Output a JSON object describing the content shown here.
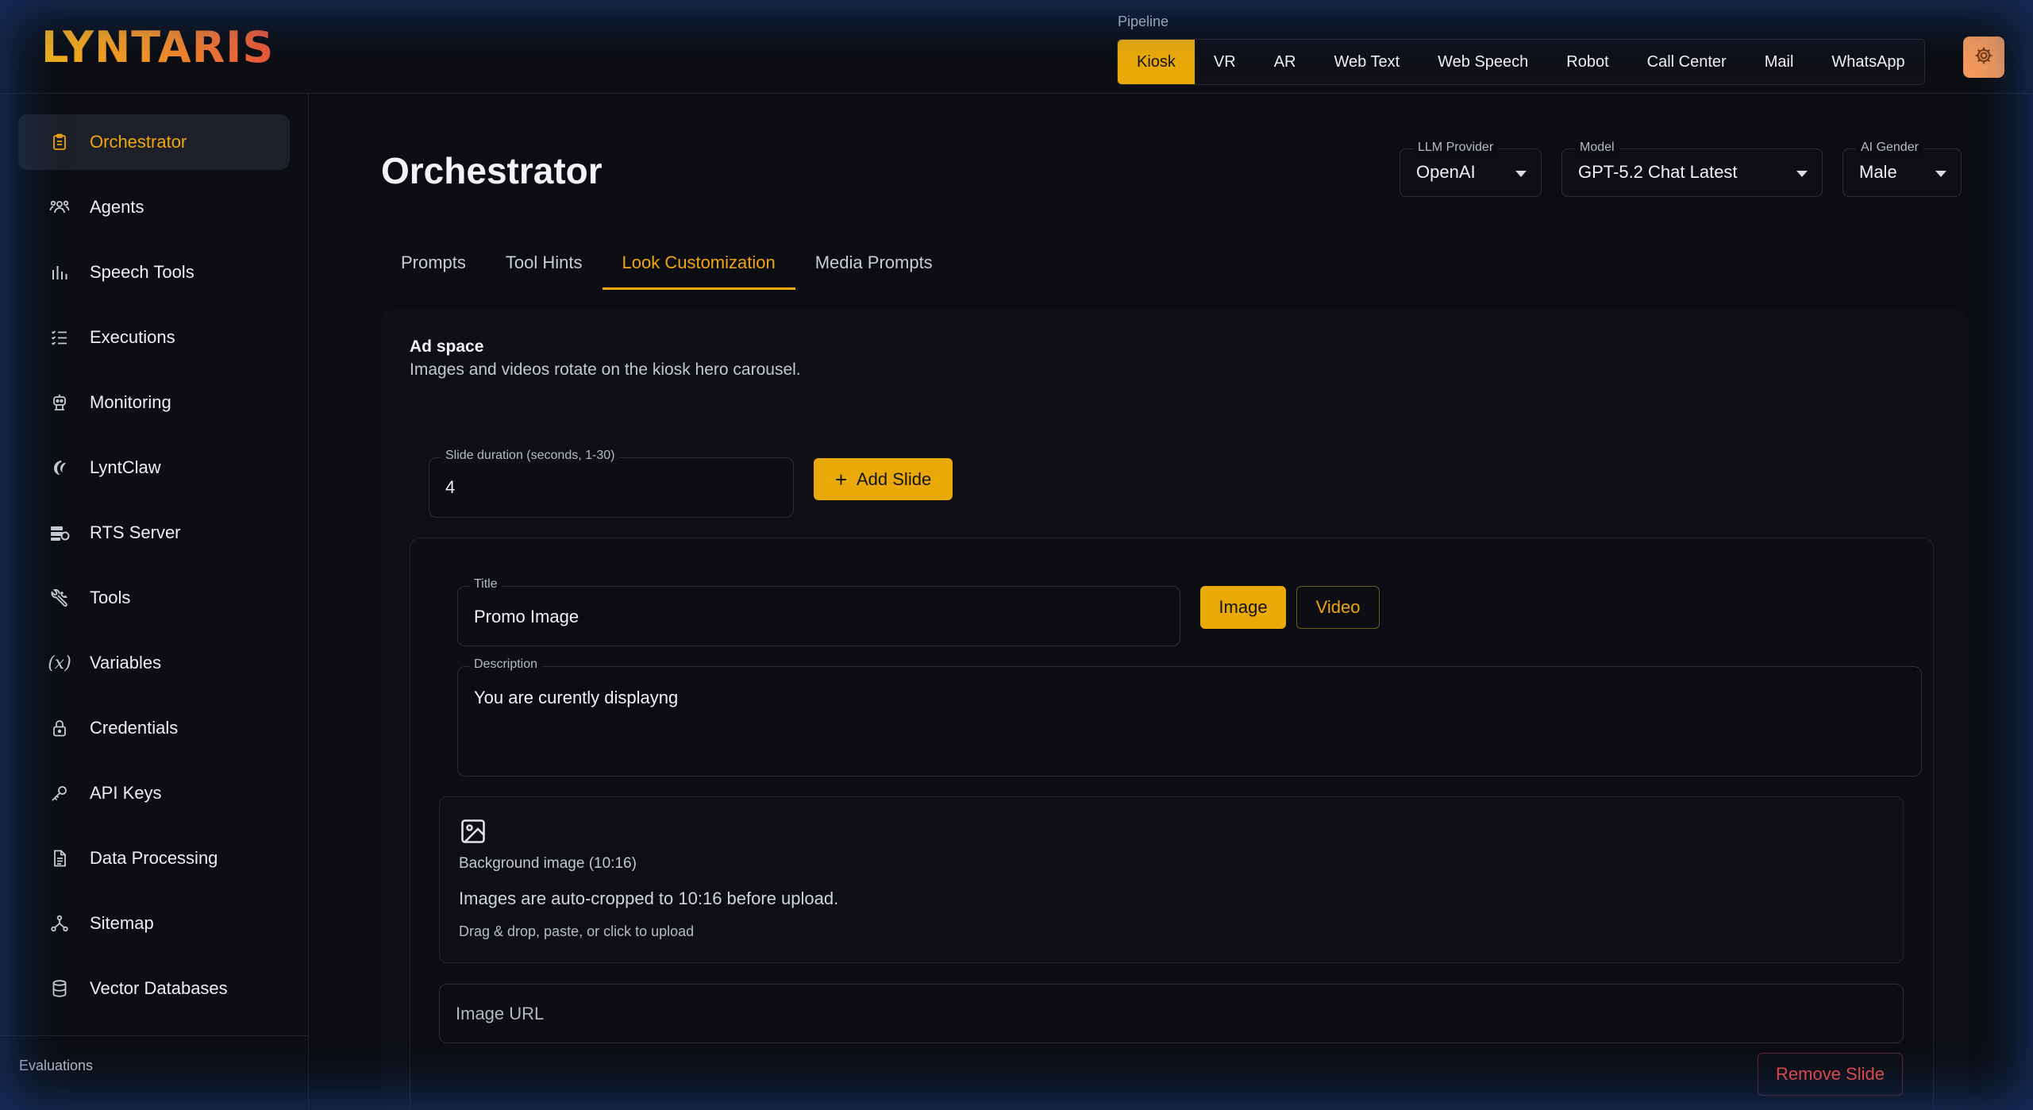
{
  "brand": {
    "logo_text": "LYNTARIS"
  },
  "pipeline": {
    "label": "Pipeline",
    "tabs": [
      "Kiosk",
      "VR",
      "AR",
      "Web Text",
      "Web Speech",
      "Robot",
      "Call Center",
      "Mail",
      "WhatsApp"
    ],
    "active": "Kiosk"
  },
  "sidebar": {
    "items": [
      {
        "label": "Orchestrator",
        "icon": "clipboard-icon",
        "active": true
      },
      {
        "label": "Agents",
        "icon": "users-icon"
      },
      {
        "label": "Speech Tools",
        "icon": "bar-chart-icon"
      },
      {
        "label": "Executions",
        "icon": "list-check-icon"
      },
      {
        "label": "Monitoring",
        "icon": "robot-icon"
      },
      {
        "label": "LyntClaw",
        "icon": "claw-icon"
      },
      {
        "label": "RTS Server",
        "icon": "server-gear-icon"
      },
      {
        "label": "Tools",
        "icon": "wrench-icon"
      },
      {
        "label": "Variables",
        "icon": "variable-icon"
      },
      {
        "label": "Credentials",
        "icon": "lock-icon"
      },
      {
        "label": "API Keys",
        "icon": "key-icon"
      },
      {
        "label": "Data Processing",
        "icon": "document-icon"
      },
      {
        "label": "Sitemap",
        "icon": "sitemap-icon"
      },
      {
        "label": "Vector Databases",
        "icon": "database-icon"
      }
    ],
    "section_label": "Evaluations"
  },
  "main": {
    "title": "Orchestrator",
    "llm_provider": {
      "label": "LLM Provider",
      "value": "OpenAI"
    },
    "model": {
      "label": "Model",
      "value": "GPT-5.2 Chat Latest"
    },
    "ai_gender": {
      "label": "AI Gender",
      "value": "Male"
    },
    "tabs": [
      "Prompts",
      "Tool Hints",
      "Look Customization",
      "Media Prompts"
    ],
    "active_tab": "Look Customization"
  },
  "ad_space": {
    "title": "Ad space",
    "subtitle": "Images and videos rotate on the kiosk hero carousel.",
    "slide_duration_label": "Slide duration (seconds, 1-30)",
    "slide_duration_value": "4",
    "add_slide_label": "Add Slide",
    "slide": {
      "title_label": "Title",
      "title_value": "Promo Image",
      "image_label": "Image",
      "video_label": "Video",
      "description_label": "Description",
      "description_value": "You are curently displayng",
      "bg_label": "Background image (10:16)",
      "bg_note": "Images are auto-cropped to 10:16 before upload.",
      "bg_hint": "Drag & drop, paste, or click to upload",
      "url_placeholder": "Image URL",
      "remove_label": "Remove Slide"
    }
  },
  "colors": {
    "accent": "#e9a909",
    "danger": "#ef4a45",
    "background": "#0b0d12"
  }
}
